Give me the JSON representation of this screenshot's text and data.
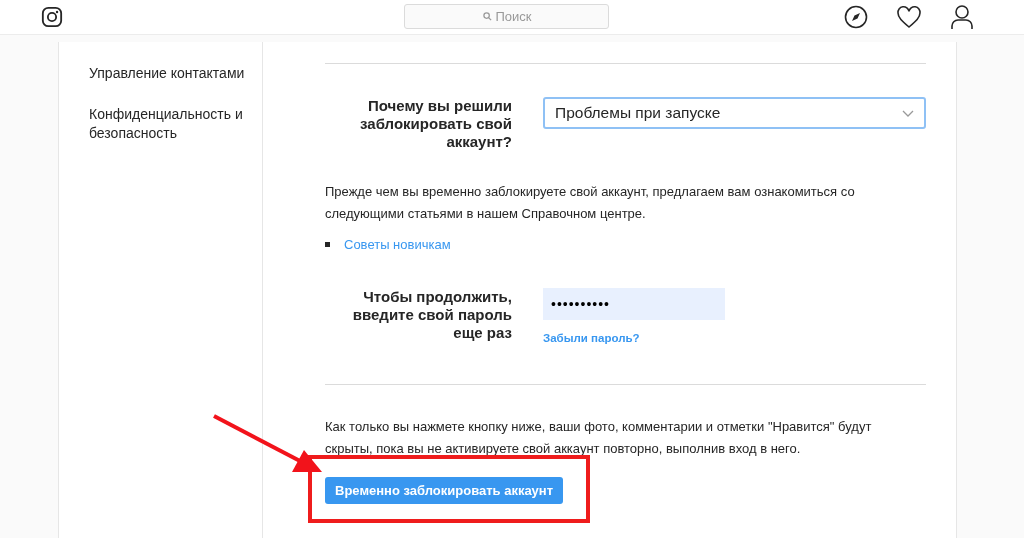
{
  "header": {
    "search": {
      "placeholder": "Поиск"
    }
  },
  "sidebar": {
    "items": [
      {
        "label": "Управление контактами",
        "selected": false
      },
      {
        "label": "Конфиденциальность и безопасность",
        "selected": false
      }
    ]
  },
  "form": {
    "reason": {
      "label": "Почему вы решили заблокировать свой аккаунт?",
      "value": "Проблемы при запуске"
    },
    "intro": "Прежде чем вы временно заблокируете свой аккаунт, предлагаем вам ознакомиться со следующими статьями в нашем Справочном центре.",
    "links": [
      "Советы новичкам"
    ],
    "password": {
      "label": "Чтобы продолжить, введите свой пароль еще раз",
      "value": "••••••••••",
      "forgot": "Забыли пароль?"
    },
    "warning": "Как только вы нажмете кнопку ниже, ваши фото, комментарии и отметки \"Нравится\" будут скрыты, пока вы не активируете свой аккаунт повторно, выполнив вход в него.",
    "button": "Временно заблокировать аккаунт"
  }
}
